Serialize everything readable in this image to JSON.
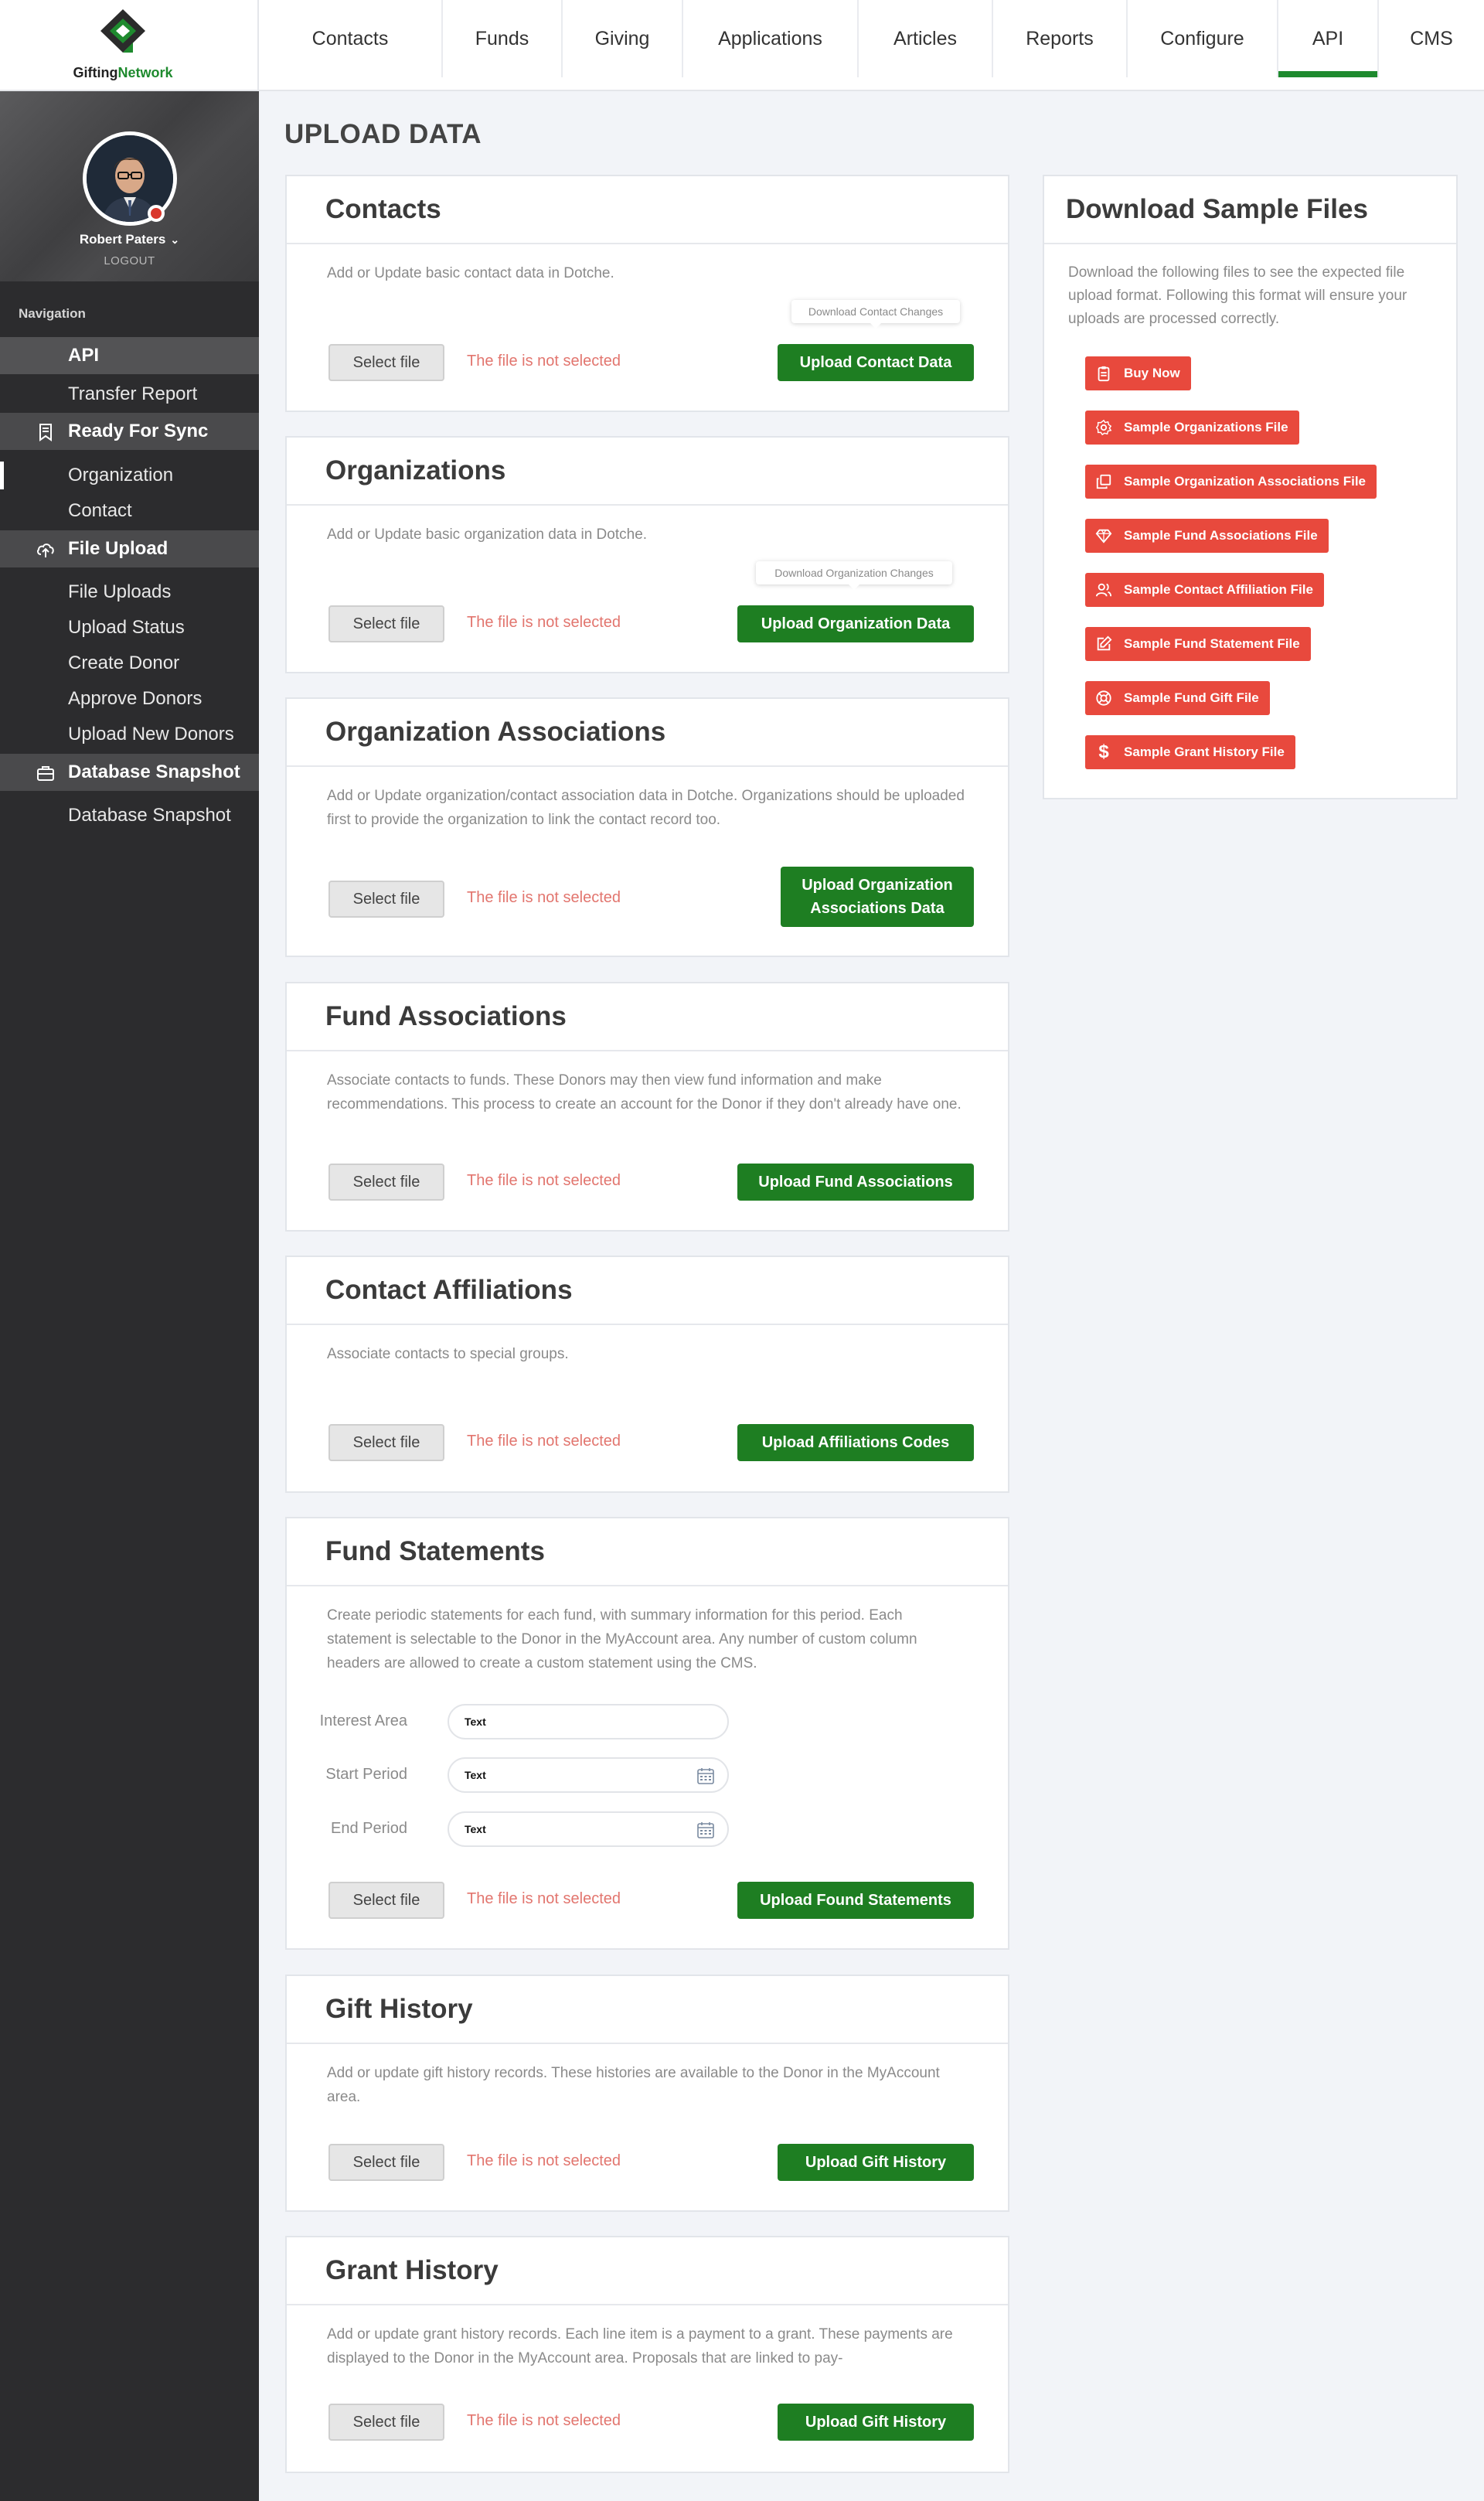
{
  "brand": {
    "name_part1": "Gifting",
    "name_part2": "Network"
  },
  "topnav": {
    "items": [
      {
        "label": "Contacts"
      },
      {
        "label": "Funds"
      },
      {
        "label": "Giving"
      },
      {
        "label": "Applications"
      },
      {
        "label": "Articles"
      },
      {
        "label": "Reports"
      },
      {
        "label": "Configure"
      },
      {
        "label": "API",
        "active": true
      },
      {
        "label": "CMS"
      }
    ]
  },
  "user": {
    "name": "Robert Paters",
    "logout": "LOGOUT"
  },
  "sidebar": {
    "nav_title": "Navigation",
    "items": [
      {
        "label": "API"
      },
      {
        "label": "Transfer Report"
      },
      {
        "label": "Ready For Sync"
      },
      {
        "label": "Organization"
      },
      {
        "label": "Contact"
      },
      {
        "label": "File Upload"
      },
      {
        "label": "File Uploads"
      },
      {
        "label": "Upload Status"
      },
      {
        "label": "Create Donor"
      },
      {
        "label": "Approve Donors"
      },
      {
        "label": "Upload New Donors"
      },
      {
        "label": "Database Snapshot"
      },
      {
        "label": "Database Snapshot"
      }
    ]
  },
  "page": {
    "title": "UPLOAD DATA"
  },
  "common": {
    "select_file": "Select file",
    "no_file": "The file is not selected"
  },
  "cards": [
    {
      "title": "Contacts",
      "desc": "Add or Update basic contact data in Dotche.",
      "button": "Upload Contact Data",
      "tooltip": "Download Contact Changes"
    },
    {
      "title": "Organizations",
      "desc": "Add or Update basic organization data in Dotche.",
      "button": "Upload Organization Data",
      "tooltip": "Download Organization Changes"
    },
    {
      "title": "Organization Associations",
      "desc": "Add or Update organization/contact association data in Dotche. Organizations should be uploaded first to provide the organization to link the contact record too.",
      "button": "Upload Organization Associations Data"
    },
    {
      "title": "Fund Associations",
      "desc": "Associate contacts to funds. These Donors may then view fund information and make recommendations. This process to create an account for the Donor if they don't already have one.",
      "button": "Upload Fund Associations"
    },
    {
      "title": "Contact Affiliations",
      "desc": "Associate contacts to special groups.",
      "button": "Upload Affiliations Codes"
    },
    {
      "title": "Fund Statements",
      "desc": "Create periodic statements for each fund, with summary information for this period. Each statement is selectable to the Donor in the MyAccount area. Any number of custom column headers are allowed to create a custom statement using the CMS.",
      "button": "Upload Found Statements",
      "fields": [
        {
          "label": "Interest Area",
          "value": "Text"
        },
        {
          "label": "Start Period",
          "value": "Text"
        },
        {
          "label": "End Period",
          "value": "Text"
        }
      ]
    },
    {
      "title": "Gift History",
      "desc": "Add or update gift history records. These histories are available to the Donor in the MyAccount area.",
      "button": "Upload Gift History"
    },
    {
      "title": "Grant History",
      "desc": "Add or update grant history records. Each line item is a payment to a grant. These payments are displayed to the Donor in the MyAccount area. Proposals that are linked to pay-",
      "button": "Upload Gift History"
    }
  ],
  "samples": {
    "title": "Download Sample Files",
    "desc": "Download the following files to see the expected file upload format. Following this format will ensure your uploads are processed correctly.",
    "buttons": [
      {
        "label": "Buy Now",
        "icon": "clipboard-icon"
      },
      {
        "label": "Sample Organizations File",
        "icon": "gear-icon"
      },
      {
        "label": "Sample Organization Associations File",
        "icon": "copy-icon"
      },
      {
        "label": "Sample Fund Associations File",
        "icon": "diamond-icon"
      },
      {
        "label": "Sample Contact Affiliation File",
        "icon": "users-icon"
      },
      {
        "label": "Sample Fund Statement File",
        "icon": "edit-icon"
      },
      {
        "label": "Sample Fund Gift File",
        "icon": "lifebuoy-icon"
      },
      {
        "label": "Sample Grant History File",
        "icon": "dollar-icon"
      }
    ]
  },
  "colors": {
    "brand_green": "#1e7e22",
    "accent_red": "#e8493d",
    "sidebar_bg": "#2c2c2e",
    "error_text": "#e2756e"
  }
}
